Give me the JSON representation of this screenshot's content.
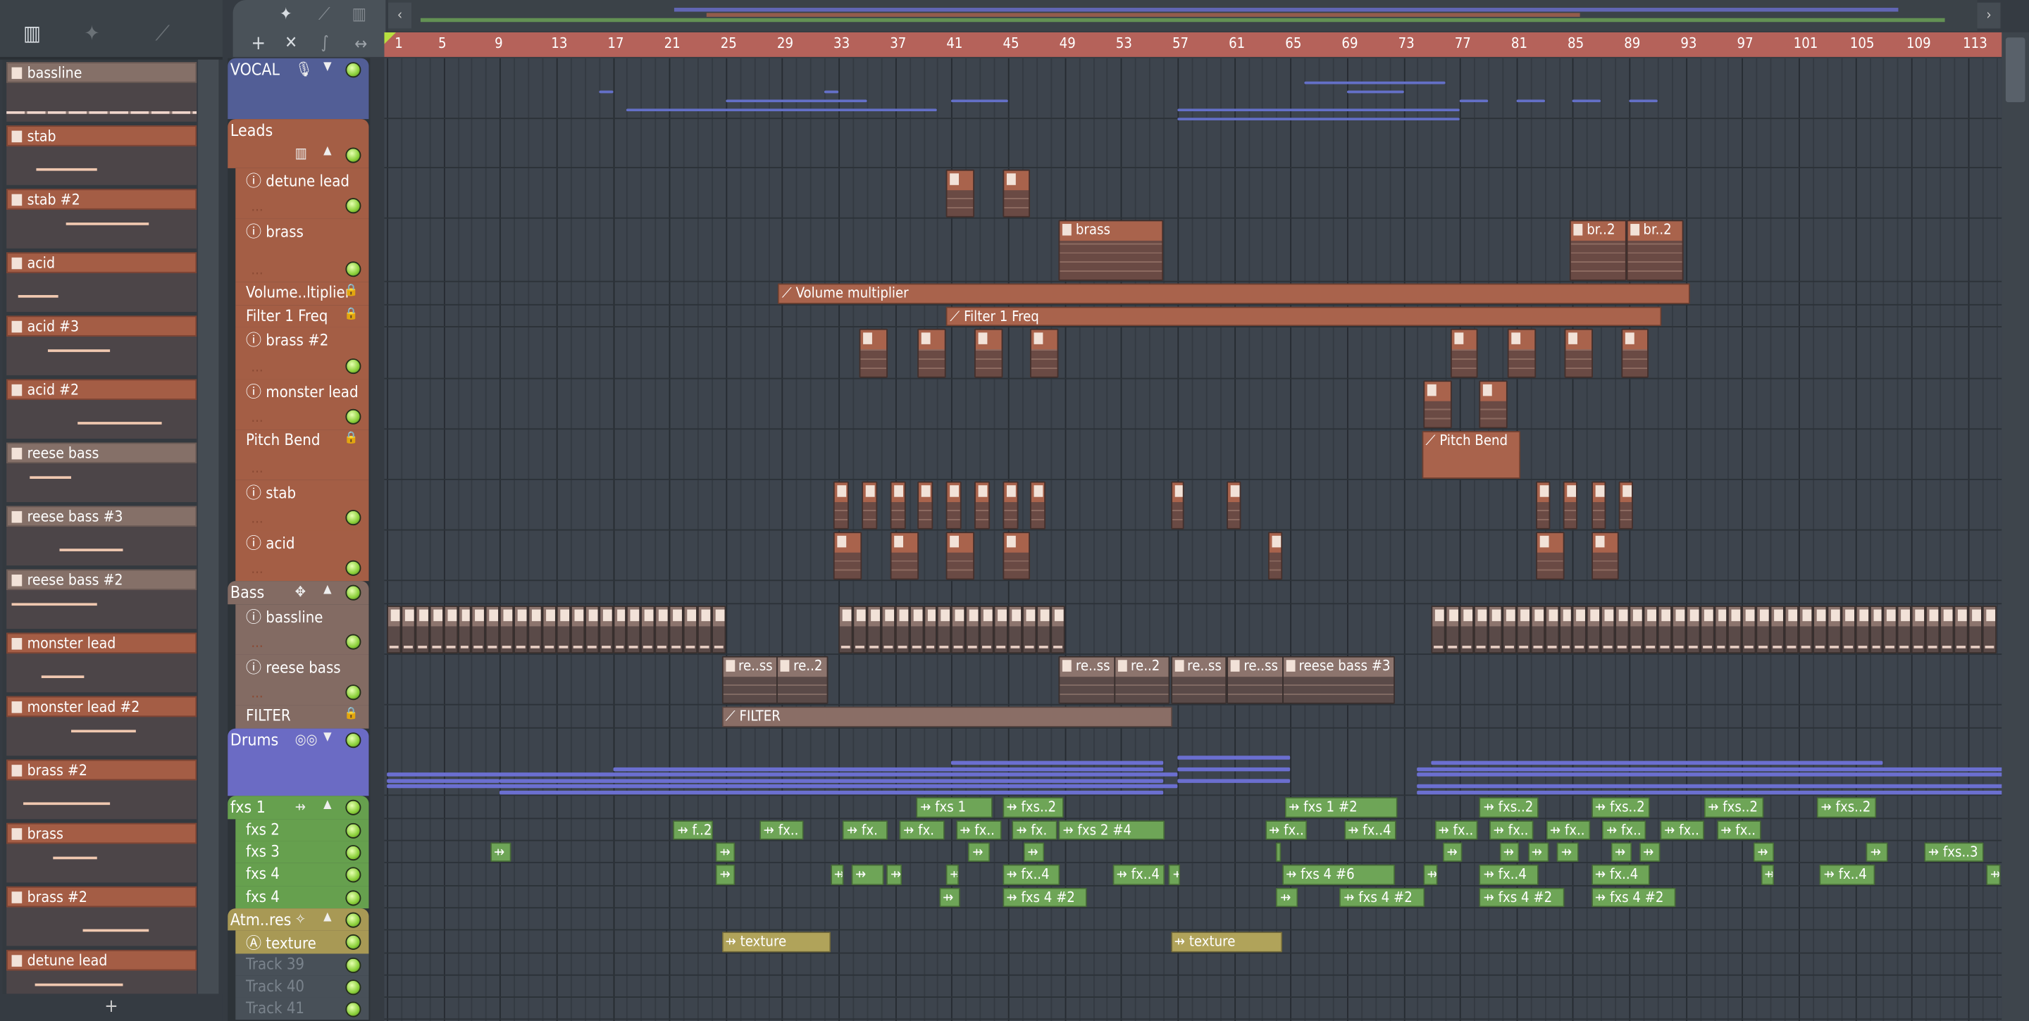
{
  "toolbar": {
    "picker_icons": [
      "piano-roll-icon",
      "audio-icon",
      "automation-icon"
    ],
    "add_label": "+",
    "tool_icons": [
      "audio-icon",
      "automation-icon",
      "piano-roll-icon",
      "add-icon",
      "delete-icon",
      "curve-icon",
      "stretch-icon"
    ]
  },
  "picker": {
    "items": [
      {
        "name": "bassline",
        "gray": true,
        "notes": "dashes"
      },
      {
        "name": "stab"
      },
      {
        "name": "stab #2"
      },
      {
        "name": "acid"
      },
      {
        "name": "acid #3"
      },
      {
        "name": "acid #2"
      },
      {
        "name": "reese bass",
        "gray": true
      },
      {
        "name": "reese bass #3",
        "gray": true
      },
      {
        "name": "reese bass #2",
        "gray": true
      },
      {
        "name": "monster lead"
      },
      {
        "name": "monster lead #2"
      },
      {
        "name": "brass #2"
      },
      {
        "name": "brass"
      },
      {
        "name": "brass #2"
      },
      {
        "name": "detune lead"
      }
    ],
    "add_label": "+"
  },
  "ruler": {
    "bars": [
      1,
      5,
      9,
      13,
      17,
      21,
      25,
      29,
      33,
      37,
      41,
      45,
      49,
      53,
      57,
      61,
      65,
      69,
      73,
      77,
      81,
      85,
      89,
      93,
      97,
      101,
      105,
      109,
      113
    ]
  },
  "colors": {
    "vocal": "#525e96",
    "leads": "#a45e45",
    "bass": "#836b63",
    "drums": "#6b6bc4",
    "fxs": "#66a04e",
    "atm": "#a89955",
    "empty": "#485058",
    "clip_lead": "#a9634c",
    "clip_lead_body": "#6a4a44",
    "clip_bass": "#8c746d",
    "clip_fx": "#6ea557",
    "clip_tex": "#b0a35a",
    "drum_line": "#6b6fd0"
  },
  "tracks": [
    {
      "name": "VOCAL",
      "group": true,
      "color": "vocal",
      "icon": "microphone-icon",
      "arrow": "▼",
      "led": true
    },
    {
      "name": "Leads",
      "group": true,
      "color": "leads",
      "icon": "piano-roll-icon",
      "arrow": "▲",
      "led": true
    },
    {
      "name": "detune lead",
      "color": "leads",
      "info": true,
      "led": true
    },
    {
      "name": "brass",
      "color": "leads",
      "info": true,
      "led": true
    },
    {
      "name": "Volume..ltiplier",
      "color": "leads",
      "lock": true
    },
    {
      "name": "Filter 1 Freq",
      "color": "leads",
      "lock": true
    },
    {
      "name": "brass #2",
      "color": "leads",
      "info": true,
      "led": true
    },
    {
      "name": "monster lead",
      "color": "leads",
      "info": true,
      "led": true
    },
    {
      "name": "Pitch Bend",
      "color": "leads",
      "lock": true
    },
    {
      "name": "stab",
      "color": "leads",
      "info": true,
      "led": true
    },
    {
      "name": "acid",
      "color": "leads",
      "info": true,
      "led": true
    },
    {
      "name": "Bass",
      "group": true,
      "color": "bass",
      "icon": "plugin-icon",
      "arrow": "▲",
      "led": true
    },
    {
      "name": "bassline",
      "color": "bass",
      "info": true,
      "led": true
    },
    {
      "name": "reese bass",
      "color": "bass",
      "info": true,
      "led": true
    },
    {
      "name": "FILTER",
      "color": "bass",
      "lock": true
    },
    {
      "name": "Drums",
      "group": true,
      "color": "drums",
      "icon": "drums-icon",
      "arrow": "▼",
      "led": true
    },
    {
      "name": "fxs 1",
      "group": true,
      "color": "fxs",
      "icon": "audio-clip-icon",
      "arrow": "▲",
      "led": true
    },
    {
      "name": "fxs 2",
      "color": "fxs",
      "led": true
    },
    {
      "name": "fxs 3",
      "color": "fxs",
      "led": true
    },
    {
      "name": "fxs 4",
      "color": "fxs",
      "led": true
    },
    {
      "name": "fxs 4",
      "color": "fxs",
      "led": true
    },
    {
      "name": "Atm..res",
      "group": true,
      "color": "atm",
      "icon": "sparkle-icon",
      "arrow": "▲",
      "led": true
    },
    {
      "name": "texture",
      "color": "atm",
      "auto": true,
      "led": true
    },
    {
      "name": "Track 39",
      "color": "empty",
      "dim": true,
      "led": true
    },
    {
      "name": "Track 40",
      "color": "empty",
      "dim": true,
      "led": true
    },
    {
      "name": "Track 41",
      "color": "empty",
      "dim": true,
      "led": true
    }
  ],
  "clips": [
    {
      "track": 2,
      "type": "pattern",
      "items": [
        [
          40.6,
          2,
          ""
        ],
        [
          44.6,
          2,
          ""
        ]
      ]
    },
    {
      "track": 3,
      "type": "pattern",
      "items": [
        [
          48.6,
          7.4,
          "brass"
        ],
        [
          84.8,
          4,
          "br..2"
        ],
        [
          88.8,
          4,
          "br..2"
        ]
      ]
    },
    {
      "track": 4,
      "type": "auto",
      "items": [
        [
          28.7,
          64.6,
          "Volume multiplier"
        ]
      ]
    },
    {
      "track": 5,
      "type": "auto",
      "items": [
        [
          40.6,
          50.7,
          "Filter 1 Freq"
        ]
      ]
    },
    {
      "track": 6,
      "type": "pattern",
      "items": [
        [
          34.5,
          2,
          ""
        ],
        [
          38.6,
          2,
          ""
        ],
        [
          42.6,
          2,
          ""
        ],
        [
          46.6,
          2,
          ""
        ],
        [
          76.3,
          2,
          ""
        ],
        [
          80.4,
          2,
          ""
        ],
        [
          84.4,
          2,
          ""
        ],
        [
          88.4,
          2,
          ""
        ]
      ]
    },
    {
      "track": 7,
      "type": "pattern",
      "items": [
        [
          74.4,
          2,
          ""
        ],
        [
          78.4,
          2,
          ""
        ]
      ]
    },
    {
      "track": 8,
      "type": "auto",
      "items": [
        [
          74.3,
          7,
          "Pitch Bend"
        ]
      ]
    },
    {
      "track": 9,
      "type": "pattern",
      "items": [
        [
          32.6,
          1.1,
          ""
        ],
        [
          34.6,
          1.1,
          ""
        ],
        [
          36.7,
          1.1,
          ""
        ],
        [
          38.6,
          1.1,
          ""
        ],
        [
          40.6,
          1.1,
          ""
        ],
        [
          42.6,
          1.1,
          ""
        ],
        [
          44.6,
          1.1,
          ""
        ],
        [
          46.6,
          1.1,
          ""
        ],
        [
          56.5,
          1,
          ""
        ],
        [
          60.5,
          1,
          ""
        ],
        [
          82.4,
          1,
          ""
        ],
        [
          84.3,
          1,
          ""
        ],
        [
          86.3,
          1,
          ""
        ],
        [
          88.3,
          1,
          ""
        ]
      ]
    },
    {
      "track": 10,
      "type": "pattern",
      "items": [
        [
          32.6,
          2,
          ""
        ],
        [
          36.7,
          2,
          ""
        ],
        [
          40.6,
          2,
          ""
        ],
        [
          44.6,
          2,
          ""
        ],
        [
          63.4,
          1,
          ""
        ],
        [
          82.4,
          2,
          ""
        ],
        [
          86.3,
          2,
          ""
        ]
      ]
    },
    {
      "track": 13,
      "type": "bass",
      "items": [
        [
          24.7,
          4,
          "re..ss"
        ],
        [
          28.6,
          3.7,
          "re..2"
        ],
        [
          48.6,
          4,
          "re..ss"
        ],
        [
          52.5,
          4,
          "re..2"
        ],
        [
          56.5,
          4,
          "re..ss"
        ],
        [
          60.5,
          4,
          "re..ss"
        ],
        [
          64.4,
          8,
          "reese bass #3"
        ]
      ]
    },
    {
      "track": 14,
      "type": "autobass",
      "items": [
        [
          24.7,
          31.9,
          "FILTER"
        ]
      ]
    },
    {
      "track": 16,
      "type": "fx",
      "items": [
        [
          38.5,
          5.4,
          "fxs 1"
        ],
        [
          44.6,
          4.3,
          "fxs..2"
        ],
        [
          64.6,
          8,
          "fxs 1 #2"
        ],
        [
          78.4,
          4.2,
          "fxs..2"
        ],
        [
          86.3,
          4.2,
          "fxs..2"
        ],
        [
          94.3,
          4.2,
          "fxs..2"
        ],
        [
          102.3,
          4.2,
          "fxs..2"
        ]
      ]
    },
    {
      "track": 17,
      "type": "fx",
      "items": [
        [
          21.3,
          2.8,
          "f..2"
        ],
        [
          27.4,
          3.1,
          "fx.."
        ],
        [
          33.3,
          3.2,
          "fx."
        ],
        [
          37.3,
          3.2,
          "fx."
        ],
        [
          41.3,
          3.2,
          "fx.."
        ],
        [
          45.3,
          3.2,
          "fx."
        ],
        [
          48.6,
          7.5,
          "fxs 2 #4"
        ],
        [
          63.2,
          3,
          "fx.."
        ],
        [
          68.8,
          3.7,
          "fx..4"
        ],
        [
          75.2,
          3.1,
          "fx.."
        ],
        [
          79.1,
          3.1,
          "fx.."
        ],
        [
          83.1,
          3.1,
          "fx.."
        ],
        [
          87.1,
          3.1,
          "fx.."
        ],
        [
          91.2,
          3.1,
          "fx.."
        ],
        [
          95.2,
          3.1,
          "fx.."
        ]
      ]
    },
    {
      "track": 18,
      "type": "fx",
      "items": [
        [
          8.3,
          1.5,
          ""
        ],
        [
          24.3,
          1.4,
          ""
        ],
        [
          42.2,
          1.5,
          ""
        ],
        [
          46.1,
          1.5,
          ""
        ],
        [
          64,
          0.3,
          ""
        ],
        [
          75.8,
          1.4,
          ""
        ],
        [
          79.8,
          1.4,
          ""
        ],
        [
          81.8,
          1.5,
          ""
        ],
        [
          83.9,
          1.5,
          ""
        ],
        [
          87.7,
          1.5,
          ""
        ],
        [
          89.7,
          1.5,
          ""
        ],
        [
          97.8,
          1.5,
          ""
        ],
        [
          105.8,
          1.5,
          ""
        ],
        [
          109.9,
          4.2,
          "fxs..3"
        ]
      ]
    },
    {
      "track": 19,
      "type": "fx",
      "items": [
        [
          24.3,
          1.4,
          ""
        ],
        [
          32.4,
          1,
          ""
        ],
        [
          33.9,
          2.3,
          ""
        ],
        [
          36.4,
          1.1,
          ""
        ],
        [
          40.6,
          0.9,
          ""
        ],
        [
          44.6,
          4.1,
          "fx..4"
        ],
        [
          52.4,
          3.7,
          "fx..4"
        ],
        [
          56.4,
          0.8,
          ""
        ],
        [
          64.4,
          8,
          "fxs 4 #6"
        ],
        [
          74.4,
          1,
          ""
        ],
        [
          78.4,
          4.2,
          "fx..4"
        ],
        [
          86.3,
          4.2,
          "fx..4"
        ],
        [
          98.3,
          1,
          ""
        ],
        [
          102.5,
          3.9,
          "fx..4"
        ],
        [
          114.3,
          1,
          ""
        ]
      ]
    },
    {
      "track": 20,
      "type": "fx",
      "items": [
        [
          40.1,
          1.5,
          ""
        ],
        [
          44.6,
          6,
          "fxs 4 #2"
        ],
        [
          64,
          1.5,
          ""
        ],
        [
          68.5,
          6,
          "fxs 4 #2"
        ],
        [
          78.4,
          6,
          "fxs 4 #2"
        ],
        [
          86.3,
          6,
          "fxs 4 #2"
        ]
      ]
    },
    {
      "track": 22,
      "type": "tex",
      "items": [
        [
          24.7,
          7.7,
          "texture"
        ],
        [
          56.5,
          7.9,
          "texture"
        ]
      ]
    }
  ],
  "bassline_ranges": [
    [
      1,
      24
    ],
    [
      33,
      48
    ],
    [
      75,
      114
    ]
  ],
  "vocal_lines": [
    [
      16,
      1,
      1
    ],
    [
      32,
      1,
      1
    ],
    [
      25,
      10,
      2
    ],
    [
      18,
      22,
      3
    ],
    [
      57,
      20,
      3
    ],
    [
      66,
      10,
      0
    ],
    [
      69,
      4,
      1
    ],
    [
      57,
      20,
      4
    ],
    [
      41,
      4,
      2
    ],
    [
      77,
      2,
      2
    ],
    [
      81,
      2,
      2
    ],
    [
      85,
      2,
      2
    ],
    [
      89,
      2,
      2
    ]
  ],
  "drum_lines": [
    [
      1,
      56,
      4
    ],
    [
      1,
      56,
      6
    ],
    [
      1,
      8,
      5
    ],
    [
      9,
      47,
      5
    ],
    [
      9,
      47,
      7
    ],
    [
      17,
      39,
      3
    ],
    [
      41,
      15,
      2
    ],
    [
      57,
      8,
      1
    ],
    [
      57,
      8,
      3
    ],
    [
      57,
      8,
      5
    ],
    [
      74,
      60,
      4
    ],
    [
      74,
      60,
      6
    ],
    [
      74,
      60,
      3
    ],
    [
      74,
      60,
      7
    ],
    [
      75,
      32,
      2
    ]
  ]
}
